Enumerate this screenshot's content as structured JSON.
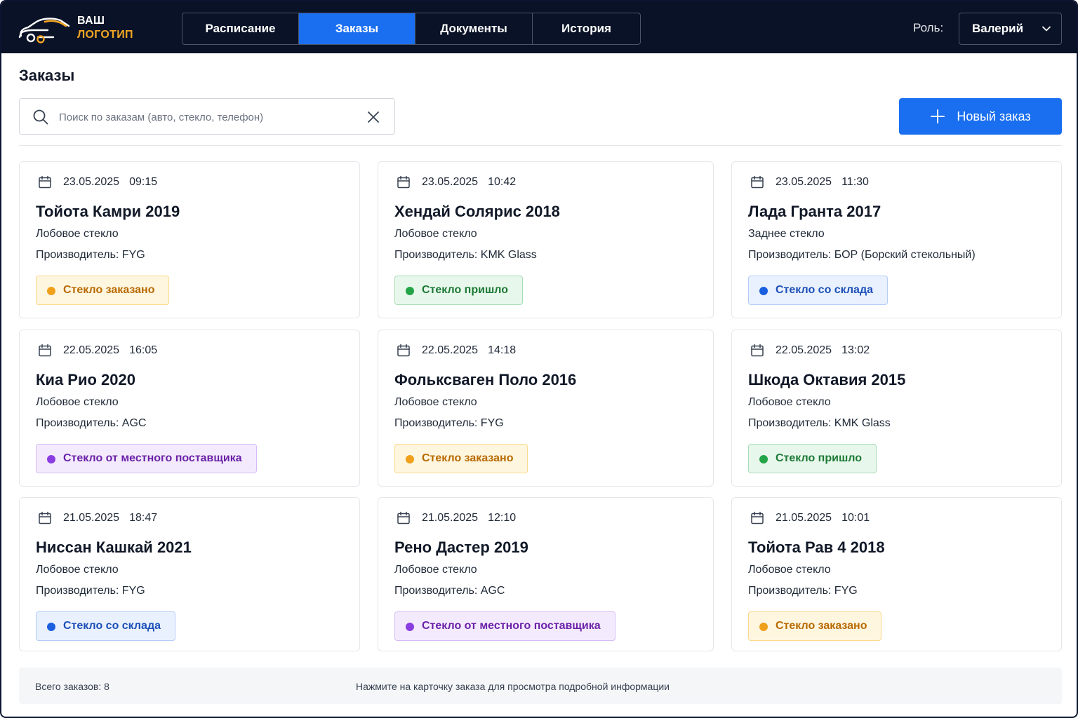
{
  "logo": {
    "line1": "ВАШ",
    "line2": "ЛОГОТИП"
  },
  "nav": [
    {
      "label": "Расписание",
      "active": false
    },
    {
      "label": "Заказы",
      "active": true
    },
    {
      "label": "Документы",
      "active": false
    },
    {
      "label": "История",
      "active": false
    }
  ],
  "role": {
    "label": "Роль:",
    "value": "Валерий"
  },
  "page": {
    "title": "Заказы"
  },
  "search": {
    "placeholder": "Поиск по заказам (авто, стекло, телефон)",
    "value": ""
  },
  "new_order": {
    "label": "Новый заказ"
  },
  "orders": [
    {
      "date": "23.05.2025",
      "time": "09:15",
      "car": "Тойота Камри 2019",
      "glass": "Лобовое стекло",
      "maker": "Производитель: FYG",
      "status": "Стекло заказано",
      "status_type": "ordered"
    },
    {
      "date": "23.05.2025",
      "time": "10:42",
      "car": "Хендай Солярис 2018",
      "glass": "Лобовое стекло",
      "maker": "Производитель: KMK Glass",
      "status": "Стекло пришло",
      "status_type": "arrived"
    },
    {
      "date": "23.05.2025",
      "time": "11:30",
      "car": "Лада Гранта 2017",
      "glass": "Заднее стекло",
      "maker": "Производитель: БОР (Борский стекольный)",
      "status": "Стекло со склада",
      "status_type": "stock"
    },
    {
      "date": "22.05.2025",
      "time": "16:05",
      "car": "Киа Рио 2020",
      "glass": "Лобовое стекло",
      "maker": "Производитель: AGC",
      "status": "Стекло от местного поставщика",
      "status_type": "local"
    },
    {
      "date": "22.05.2025",
      "time": "14:18",
      "car": "Фольксваген Поло 2016",
      "glass": "Лобовое стекло",
      "maker": "Производитель: FYG",
      "status": "Стекло заказано",
      "status_type": "ordered"
    },
    {
      "date": "22.05.2025",
      "time": "13:02",
      "car": "Шкода Октавия 2015",
      "glass": "Лобовое стекло",
      "maker": "Производитель: KMK Glass",
      "status": "Стекло пришло",
      "status_type": "arrived"
    },
    {
      "date": "21.05.2025",
      "time": "18:47",
      "car": "Ниссан Кашкай 2021",
      "glass": "Лобовое стекло",
      "maker": "Производитель: FYG",
      "status": "Стекло со склада",
      "status_type": "stock"
    },
    {
      "date": "21.05.2025",
      "time": "12:10",
      "car": "Рено Дастер 2019",
      "glass": "Лобовое стекло",
      "maker": "Производитель: AGC",
      "status": "Стекло от местного поставщика",
      "status_type": "local"
    },
    {
      "date": "21.05.2025",
      "time": "10:01",
      "car": "Тойота Рав 4 2018",
      "glass": "Лобовое стекло",
      "maker": "Производитель: FYG",
      "status": "Стекло заказано",
      "status_type": "ordered"
    }
  ],
  "footer": {
    "total": "Всего заказов: 8",
    "hint": "Нажмите на карточку заказа для просмотра подробной информации"
  },
  "colors": {
    "header_bg": "#091226",
    "accent": "#1a6ff0",
    "logo_accent": "#f5a524"
  },
  "icons": {
    "logo": "car-logo-icon",
    "search": "search-icon",
    "clear": "close-icon",
    "add": "plus-icon",
    "date": "calendar-icon",
    "dropdown": "chevron-down-icon"
  }
}
